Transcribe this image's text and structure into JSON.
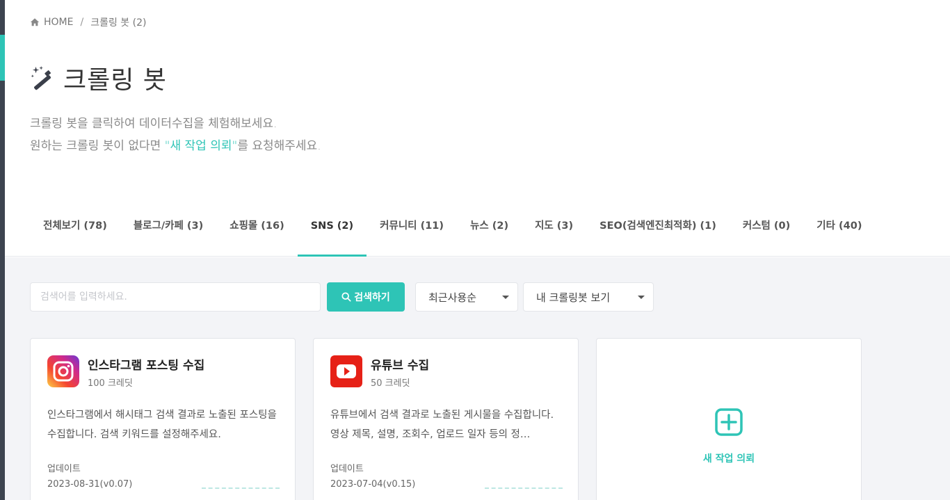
{
  "breadcrumb": {
    "home": "HOME",
    "current": "크롤링 봇 (2)"
  },
  "page": {
    "title": "크롤링 봇",
    "desc_line1": "크롤링 봇을 클릭하여 데이터수집을 체험해보세요.",
    "desc_line2_pre": "원하는 크롤링 봇이 없다면 ",
    "desc_line2_link": "\"새 작업 의뢰\"",
    "desc_line2_post": "를 요청해주세요."
  },
  "tabs": [
    {
      "label": "전체보기 (78)"
    },
    {
      "label": "블로그/카페 (3)"
    },
    {
      "label": "쇼핑몰 (16)"
    },
    {
      "label": "SNS (2)",
      "active": true
    },
    {
      "label": "커뮤니티 (11)"
    },
    {
      "label": "뉴스 (2)"
    },
    {
      "label": "지도 (3)"
    },
    {
      "label": "SEO(검색엔진최적화) (1)"
    },
    {
      "label": "커스텀 (0)"
    },
    {
      "label": "기타 (40)"
    }
  ],
  "filters": {
    "search_placeholder": "검색어를 입력하세요.",
    "search_button": "검색하기",
    "sort_selected": "최근사용순",
    "mine_selected": "내 크롤링봇 보기"
  },
  "cards": [
    {
      "name": "인스타그램 포스팅 수집",
      "credit": "100 크레딧",
      "description": "인스타그램에서 해시태그 검색 결과로 노출된 포스팅을 수집합니다. 검색 키워드를 설정해주세요.",
      "update_label": "업데이트",
      "update_date": "2023-08-31(v0.07)",
      "icon": "instagram-icon"
    },
    {
      "name": "유튜브 수집",
      "credit": "50 크레딧",
      "description": "유튜브에서 검색 결과로 노출된 게시물을 수집합니다. 영상 제목, 설명, 조회수, 업로드 일자 등의 정…",
      "update_label": "업데이트",
      "update_date": "2023-07-04(v0.15)",
      "icon": "youtube-icon"
    }
  ],
  "new_request": {
    "label": "새 작업 의뢰"
  },
  "colors": {
    "accent": "#2ec4b6",
    "rail": "#3d4450",
    "youtube": "#e62117"
  }
}
